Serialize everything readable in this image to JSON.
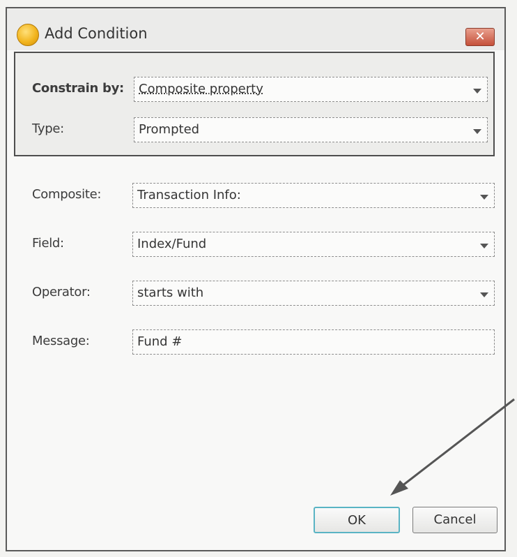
{
  "dialog": {
    "title": "Add Condition",
    "close_label": "✕"
  },
  "top_panel": {
    "constrain_by_label": "Constrain by:",
    "constrain_by_value": "Composite property",
    "type_label": "Type:",
    "type_value": "Prompted"
  },
  "form": {
    "composite_label": "Composite:",
    "composite_value": "Transaction Info:",
    "field_label": "Field:",
    "field_value": "Index/Fund",
    "operator_label": "Operator:",
    "operator_value": "starts with",
    "message_label": "Message:",
    "message_value": "Fund #"
  },
  "buttons": {
    "ok_label": "OK",
    "cancel_label": "Cancel"
  },
  "colors": {
    "ok_focus_border": "#5ab4c4",
    "close_button": "#c5503a",
    "title_icon": "#f2b51f",
    "annotation_arrow": "#555555"
  }
}
